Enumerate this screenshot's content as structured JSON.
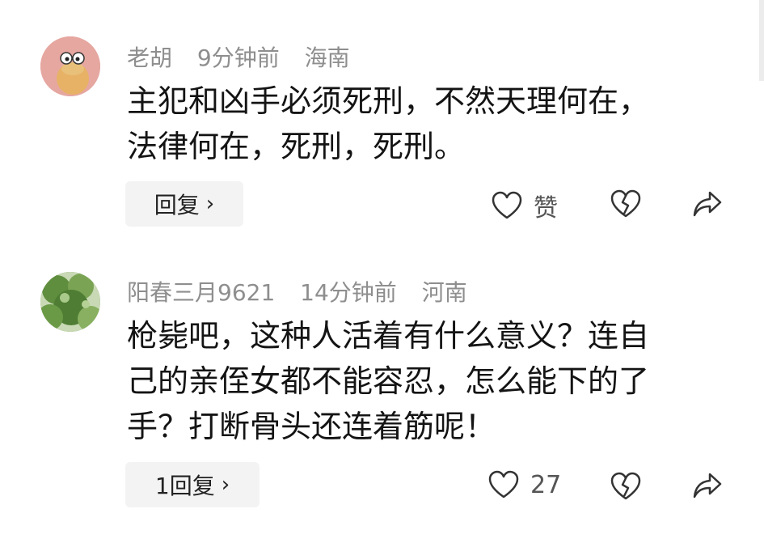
{
  "comments": [
    {
      "username": "老胡",
      "time": "9分钟前",
      "location": "海南",
      "text_lines": [
        "主犯和凶手必须死刑，不然天理何在，",
        "法律何在，死刑，死刑。"
      ],
      "reply_label": "回复",
      "like_label": "赞",
      "avatar_icon": "cartoon-chick-avatar"
    },
    {
      "username": "阳春三月9621",
      "time": "14分钟前",
      "location": "河南",
      "text_lines": [
        "枪毙吧，这种人活着有什么意义？连自",
        "己的亲侄女都不能容忍，怎么能下的了",
        "手？打断骨头还连着筋呢！"
      ],
      "reply_label": "1回复",
      "like_label": "27",
      "avatar_icon": "green-tree-photo-avatar"
    }
  ],
  "icons": {
    "like": "heart-outline-icon",
    "dislike": "broken-heart-icon",
    "share": "share-arrow-icon",
    "reply_chevron": "chevron-right-icon"
  },
  "colors": {
    "meta_text": "#8e8e8e",
    "body_text": "#141414",
    "reply_bg": "#f3f3f3",
    "icon_stroke": "#333333"
  }
}
